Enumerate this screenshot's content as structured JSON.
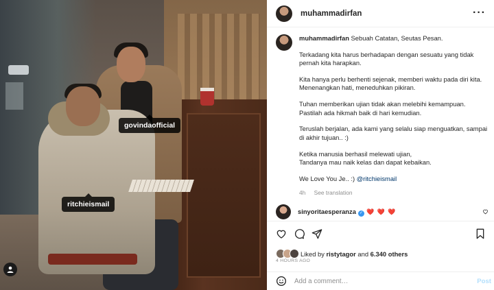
{
  "photo": {
    "tags": {
      "govinda": "govindaofficial",
      "ritchie": "ritchieismail"
    }
  },
  "header": {
    "username": "muhammadirfan",
    "more_icon": "more-horizontal-icon"
  },
  "caption": {
    "username": "muhammadirfan",
    "title": "Sebuah Catatan, Seutas Pesan.",
    "p1": "Terkadang kita harus berhadapan dengan sesuatu yang tidak pernah kita harapkan.",
    "p2": "Kita hanya perlu berhenti sejenak, memberi waktu pada diri kita. Menenangkan hati, meneduhkan pikiran.",
    "p3": "Tuhan memberikan ujian tidak akan melebihi kemampuan. Pastilah ada hikmah baik di hari kemudian.",
    "p4": "Teruslah berjalan, ada kami yang selalu siap menguatkan, sampai di akhir tujuan.. :)",
    "p5a": "Ketika manusia berhasil melewati ujian,",
    "p5b": "Tandanya mau naik kelas dan dapat kebaikan.",
    "p6": "We Love You Je.. :) ",
    "mention": "@ritchieismail",
    "time": "4h",
    "see_translation": "See translation"
  },
  "comment": {
    "username": "sinyoritaesperanza",
    "hearts": "❤️ ❤️ ❤️"
  },
  "likes": {
    "liked_by": "Liked by ",
    "user": "ristytagor",
    "and": " and ",
    "count": "6.340 others"
  },
  "time_ago": "4 HOURS AGO",
  "add_comment": {
    "placeholder": "Add a comment…",
    "post": "Post"
  }
}
